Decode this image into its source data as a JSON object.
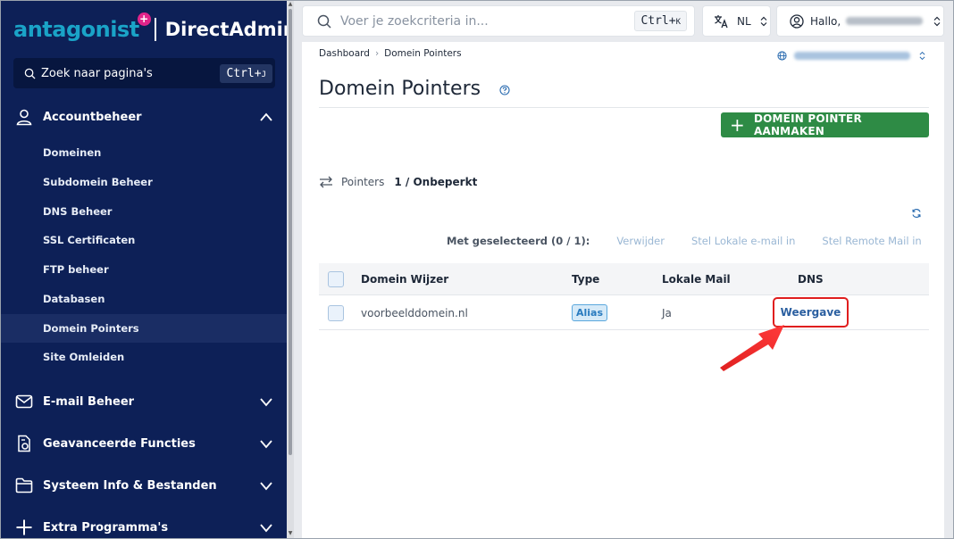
{
  "sidebar": {
    "logo_brand": "antagonist",
    "logo_cross": "+",
    "logo_product": "DirectAdmin",
    "search_placeholder": "Zoek naar pagina's",
    "search_kbd": "Ctrl+",
    "search_kbd_key": "J",
    "sections": [
      {
        "label": "Accountbeheer",
        "icon": "user-icon",
        "expanded": true
      },
      {
        "label": "E-mail Beheer",
        "icon": "mail-icon",
        "expanded": false
      },
      {
        "label": "Geavanceerde Functies",
        "icon": "settings-file-icon",
        "expanded": false
      },
      {
        "label": "Systeem Info & Bestanden",
        "icon": "folder-icon",
        "expanded": false
      },
      {
        "label": "Extra Programma's",
        "icon": "plus-icon",
        "expanded": false
      }
    ],
    "account_items": [
      "Domeinen",
      "Subdomein Beheer",
      "DNS Beheer",
      "SSL Certificaten",
      "FTP beheer",
      "Databasen",
      "Domein Pointers",
      "Site Omleiden"
    ],
    "active_item": "Domein Pointers",
    "colors": {
      "background": "#0d2057",
      "active": "#1a2d64",
      "brand": "#1aa3c7",
      "cross": "#e0248a"
    }
  },
  "topbar": {
    "search_placeholder": "Voer je zoekcriteria in...",
    "search_kbd": "Ctrl+",
    "search_kbd_key": "K",
    "language": "NL",
    "greeting": "Hallo,"
  },
  "main": {
    "breadcrumb": [
      "Dashboard",
      "Domein Pointers"
    ],
    "page_title": "Domein Pointers",
    "create_button": "DOMEIN POINTER AANMAKEN",
    "pointers_label": "Pointers",
    "pointers_value": "1 / Onbeperkt",
    "bulk": {
      "selected": "Met geselecteerd (0 / 1):",
      "actions": [
        "Verwijder",
        "Stel Lokale e-mail in",
        "Stel Remote Mail in"
      ]
    },
    "table": {
      "headers": [
        "Domein Wijzer",
        "Type",
        "Lokale Mail",
        "DNS"
      ],
      "rows": [
        {
          "domain": "voorbeelddomein.nl",
          "type": "Alias",
          "local_mail": "Ja",
          "dns": "Weergave"
        }
      ]
    },
    "colors": {
      "create_button": "#2e8b45",
      "highlight": "#e01e1e",
      "link": "#2b5fa0"
    }
  }
}
